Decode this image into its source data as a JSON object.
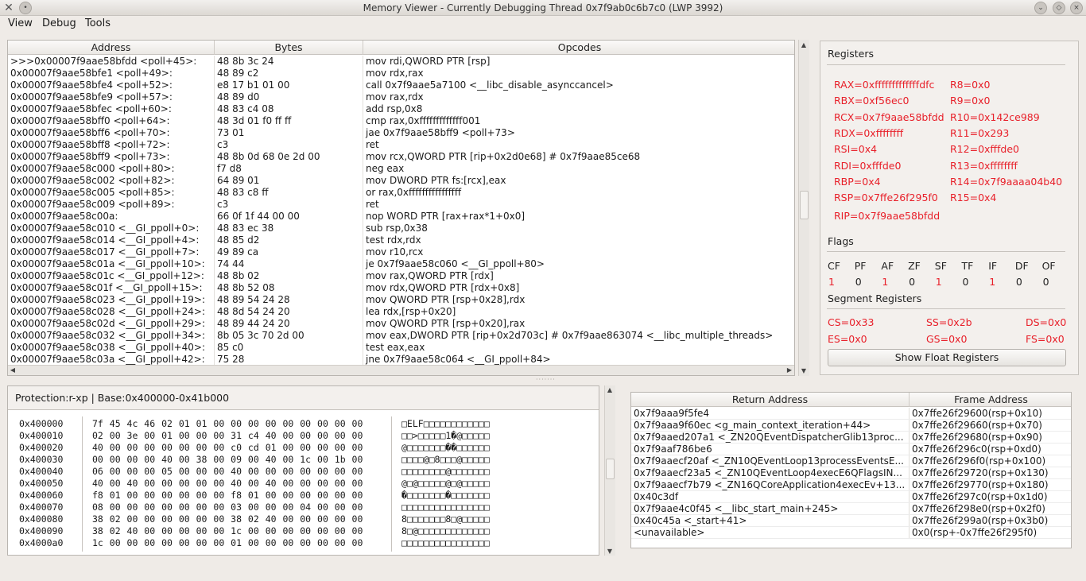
{
  "window": {
    "title": "Memory Viewer - Currently Debugging Thread 0x7f9ab0c6b7c0 (LWP 3992)"
  },
  "menu": [
    "View",
    "Debug",
    "Tools"
  ],
  "disasm": {
    "headers": [
      "Address",
      "Bytes",
      "Opcodes"
    ],
    "rows": [
      [
        ">>>0x00007f9aae58bfdd <poll+45>:",
        "48 8b 3c 24",
        "mov    rdi,QWORD PTR [rsp]"
      ],
      [
        "0x00007f9aae58bfe1 <poll+49>:",
        "48 89 c2",
        "mov    rdx,rax"
      ],
      [
        "0x00007f9aae58bfe4 <poll+52>:",
        "e8 17 b1 01 00",
        "call   0x7f9aae5a7100 <__libc_disable_asynccancel>"
      ],
      [
        "0x00007f9aae58bfe9 <poll+57>:",
        "48 89 d0",
        "mov    rax,rdx"
      ],
      [
        "0x00007f9aae58bfec <poll+60>:",
        "48 83 c4 08",
        "add    rsp,0x8"
      ],
      [
        "0x00007f9aae58bff0 <poll+64>:",
        "48 3d 01 f0 ff ff",
        "cmp    rax,0xfffffffffffff001"
      ],
      [
        "0x00007f9aae58bff6 <poll+70>:",
        "73 01",
        "jae    0x7f9aae58bff9 <poll+73>"
      ],
      [
        "0x00007f9aae58bff8 <poll+72>:",
        "c3",
        "ret"
      ],
      [
        "0x00007f9aae58bff9 <poll+73>:",
        "48 8b 0d 68 0e 2d 00",
        "mov    rcx,QWORD PTR [rip+0x2d0e68]        # 0x7f9aae85ce68"
      ],
      [
        "0x00007f9aae58c000 <poll+80>:",
        "f7 d8",
        "neg    eax"
      ],
      [
        "0x00007f9aae58c002 <poll+82>:",
        "64 89 01",
        "mov    DWORD PTR fs:[rcx],eax"
      ],
      [
        "0x00007f9aae58c005 <poll+85>:",
        "48 83 c8 ff",
        "or     rax,0xffffffffffffffff"
      ],
      [
        "0x00007f9aae58c009 <poll+89>:",
        "c3",
        "ret"
      ],
      [
        "0x00007f9aae58c00a:",
        "66 0f 1f 44 00 00",
        "nop    WORD PTR [rax+rax*1+0x0]"
      ],
      [
        "0x00007f9aae58c010 <__GI_ppoll+0>:",
        "48 83 ec 38",
        "sub    rsp,0x38"
      ],
      [
        "0x00007f9aae58c014 <__GI_ppoll+4>:",
        "48 85 d2",
        "test   rdx,rdx"
      ],
      [
        "0x00007f9aae58c017 <__GI_ppoll+7>:",
        "49 89 ca",
        "mov    r10,rcx"
      ],
      [
        "0x00007f9aae58c01a <__GI_ppoll+10>:",
        "74 44",
        "je     0x7f9aae58c060 <__GI_ppoll+80>"
      ],
      [
        "0x00007f9aae58c01c <__GI_ppoll+12>:",
        "48 8b 02",
        "mov    rax,QWORD PTR [rdx]"
      ],
      [
        "0x00007f9aae58c01f <__GI_ppoll+15>:",
        "48 8b 52 08",
        "mov    rdx,QWORD PTR [rdx+0x8]"
      ],
      [
        "0x00007f9aae58c023 <__GI_ppoll+19>:",
        "48 89 54 24 28",
        "mov    QWORD PTR [rsp+0x28],rdx"
      ],
      [
        "0x00007f9aae58c028 <__GI_ppoll+24>:",
        "48 8d 54 24 20",
        "lea    rdx,[rsp+0x20]"
      ],
      [
        "0x00007f9aae58c02d <__GI_ppoll+29>:",
        "48 89 44 24 20",
        "mov    QWORD PTR [rsp+0x20],rax"
      ],
      [
        "0x00007f9aae58c032 <__GI_ppoll+34>:",
        "8b 05 3c 70 2d 00",
        "mov    eax,DWORD PTR [rip+0x2d703c]        # 0x7f9aae863074 <__libc_multiple_threads>"
      ],
      [
        "0x00007f9aae58c038 <__GI_ppoll+40>:",
        "85 c0",
        "test   eax,eax"
      ],
      [
        "0x00007f9aae58c03a <__GI_ppoll+42>:",
        "75 28",
        "jne    0x7f9aae58c064 <__GI_ppoll+84>"
      ]
    ]
  },
  "registers": {
    "title": "Registers",
    "left": [
      "RAX=0xfffffffffffffdfc",
      "RBX=0xf56ec0",
      "RCX=0x7f9aae58bfdd",
      "RDX=0xffffffff",
      "RSI=0x4",
      "RDI=0xfffde0",
      "RBP=0x4",
      "RSP=0x7ffe26f295f0",
      "RIP=0x7f9aae58bfdd"
    ],
    "right": [
      "R8=0x0",
      "R9=0x0",
      "R10=0x142ce989",
      "R11=0x293",
      "R12=0xfffde0",
      "R13=0xffffffff",
      "R14=0x7f9aaaa04b40",
      "R15=0x4"
    ],
    "flags_title": "Flags",
    "flag_names": [
      "CF",
      "PF",
      "AF",
      "ZF",
      "SF",
      "TF",
      "IF",
      "DF",
      "OF"
    ],
    "flag_values": [
      "1",
      "0",
      "1",
      "0",
      "1",
      "0",
      "1",
      "0",
      "0"
    ],
    "flag_changed": [
      true,
      false,
      true,
      false,
      true,
      false,
      true,
      false,
      false
    ],
    "segment_title": "Segment Registers",
    "segments": [
      "CS=0x33",
      "SS=0x2b",
      "DS=0x0",
      "ES=0x0",
      "GS=0x0",
      "FS=0x0"
    ],
    "float_button": "Show Float Registers",
    "changed_color": "#e8202a"
  },
  "hex": {
    "header": "Protection:r-xp | Base:0x400000-0x41b000",
    "rows": [
      {
        "addr": "0x400000",
        "bytes": "7f 45 4c 46 02 01 01 00 00 00 00 00 00 00 00 00",
        "ascii": "□ELF□□□□□□□□□□□□"
      },
      {
        "addr": "0x400010",
        "bytes": "02 00 3e 00 01 00 00 00 31 c4 40 00 00 00 00 00",
        "ascii": "□□>□□□□□1�@□□□□□"
      },
      {
        "addr": "0x400020",
        "bytes": "40 00 00 00 00 00 00 00 c0 cd 01 00 00 00 00 00",
        "ascii": "@□□□□□□□��□□□□□□"
      },
      {
        "addr": "0x400030",
        "bytes": "00 00 00 00 40 00 38 00 09 00 40 00 1c 00 1b 00",
        "ascii": "□□□□@□8□□□@□□□□□"
      },
      {
        "addr": "0x400040",
        "bytes": "06 00 00 00 05 00 00 00 40 00 00 00 00 00 00 00",
        "ascii": "□□□□□□□□@□□□□□□□"
      },
      {
        "addr": "0x400050",
        "bytes": "40 00 40 00 00 00 00 00 40 00 40 00 00 00 00 00",
        "ascii": "@□@□□□□□@□@□□□□□"
      },
      {
        "addr": "0x400060",
        "bytes": "f8 01 00 00 00 00 00 00 f8 01 00 00 00 00 00 00",
        "ascii": "�□□□□□□□�□□□□□□□"
      },
      {
        "addr": "0x400070",
        "bytes": "08 00 00 00 00 00 00 00 03 00 00 00 04 00 00 00",
        "ascii": "□□□□□□□□□□□□□□□□"
      },
      {
        "addr": "0x400080",
        "bytes": "38 02 00 00 00 00 00 00 38 02 40 00 00 00 00 00",
        "ascii": "8□□□□□□□8□@□□□□□"
      },
      {
        "addr": "0x400090",
        "bytes": "38 02 40 00 00 00 00 00 1c 00 00 00 00 00 00 00",
        "ascii": "8□@□□□□□□□□□□□□□"
      },
      {
        "addr": "0x4000a0",
        "bytes": "1c 00 00 00 00 00 00 00 01 00 00 00 00 00 00 00",
        "ascii": "□□□□□□□□□□□□□□□□"
      }
    ]
  },
  "stack": {
    "headers": [
      "Return Address",
      "Frame Address"
    ],
    "rows": [
      [
        "0x7f9aaa9f5fe4",
        "0x7ffe26f29600(rsp+0x10)"
      ],
      [
        "0x7f9aaa9f60ec <g_main_context_iteration+44>",
        "0x7ffe26f29660(rsp+0x70)"
      ],
      [
        "0x7f9aaed207a1 <_ZN20QEventDispatcherGlib13proc...",
        "0x7ffe26f29680(rsp+0x90)"
      ],
      [
        "0x7f9aaf786be6",
        "0x7ffe26f296c0(rsp+0xd0)"
      ],
      [
        "0x7f9aaecf20af <_ZN10QEventLoop13processEventsE...",
        "0x7ffe26f296f0(rsp+0x100)"
      ],
      [
        "0x7f9aaecf23a5 <_ZN10QEventLoop4execE6QFlagsIN...",
        "0x7ffe26f29720(rsp+0x130)"
      ],
      [
        "0x7f9aaecf7b79 <_ZN16QCoreApplication4execEv+13...",
        "0x7ffe26f29770(rsp+0x180)"
      ],
      [
        "0x40c3df",
        "0x7ffe26f297c0(rsp+0x1d0)"
      ],
      [
        "0x7f9aae4c0f45 <__libc_start_main+245>",
        "0x7ffe26f298e0(rsp+0x2f0)"
      ],
      [
        "0x40c45a <_start+41>",
        "0x7ffe26f299a0(rsp+0x3b0)"
      ],
      [
        "<unavailable>",
        "0x0(rsp+-0x7ffe26f295f0)"
      ]
    ]
  }
}
